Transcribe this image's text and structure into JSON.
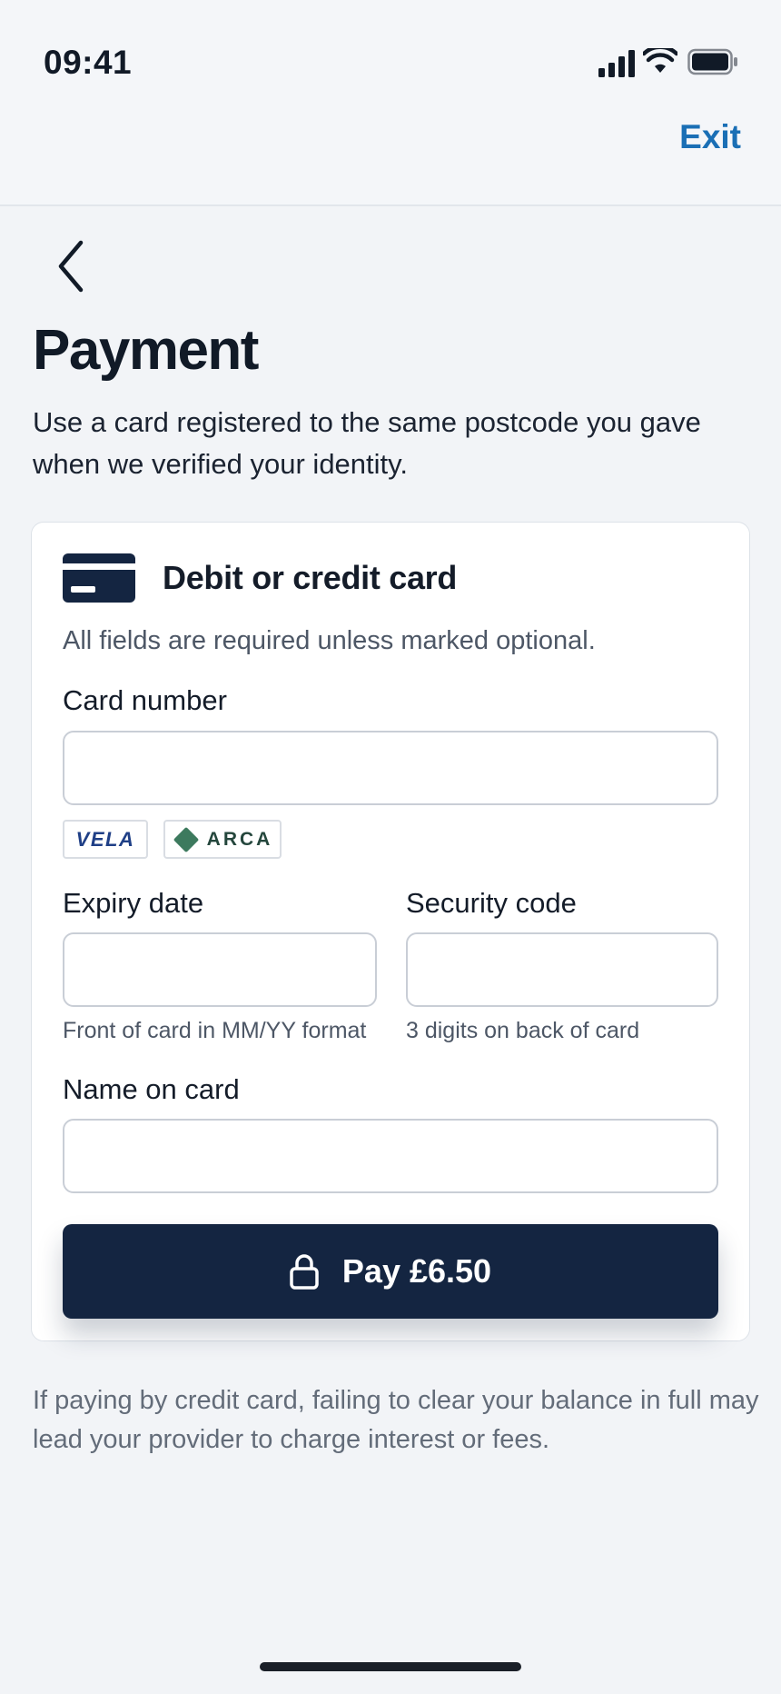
{
  "status_bar": {
    "time": "09:41"
  },
  "header": {
    "exit_label": "Exit"
  },
  "page": {
    "title": "Payment",
    "intro": "Use a card registered to the same postcode you gave when we verified your identity."
  },
  "card_form": {
    "heading": "Debit or credit card",
    "required_note": "All fields are required unless marked optional.",
    "card_number": {
      "label": "Card number",
      "value": "",
      "icon": "card-generic-icon"
    },
    "brands": [
      {
        "name": "VELA"
      },
      {
        "name": "ARCA"
      }
    ],
    "expiry": {
      "label": "Expiry date",
      "value": "",
      "hint": "Front of card in MM/YY format",
      "icon": "card-front-icon"
    },
    "security_code": {
      "label": "Security code",
      "value": "",
      "hint": "3 digits on back of card",
      "icon": "card-back-icon"
    },
    "name_on_card": {
      "label": "Name on card",
      "value": ""
    },
    "pay_button": {
      "label": "Pay £6.50",
      "icon": "lock-icon"
    }
  },
  "footer_note": "If paying by credit card, failing to clear your balance in full may lead your provider to charge interest or fees.",
  "colors": {
    "accent": "#1a6fb5",
    "button": "#142541",
    "background": "#f2f4f7",
    "arca_green": "#3d7a5e",
    "cvv_ring": "#c0392b"
  }
}
